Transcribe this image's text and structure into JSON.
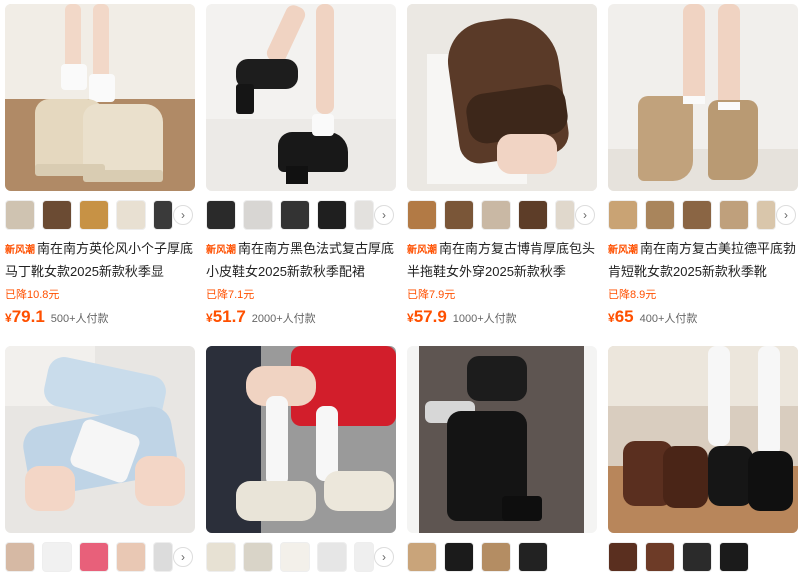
{
  "products": [
    {
      "badge": "新风潮",
      "title": "南在南方英伦风小个子厚底马丁靴女款2025新款秋季显",
      "dropped": "已降10.8元",
      "currency": "¥",
      "price": "79.1",
      "sold": "500+人付款"
    },
    {
      "badge": "新风潮",
      "title": "南在南方黑色法式复古厚底小皮鞋女2025新款秋季配裙",
      "dropped": "已降7.1元",
      "currency": "¥",
      "price": "51.7",
      "sold": "2000+人付款"
    },
    {
      "badge": "新风潮",
      "title": "南在南方复古博肯厚底包头半拖鞋女外穿2025新款秋季",
      "dropped": "已降7.9元",
      "currency": "¥",
      "price": "57.9",
      "sold": "1000+人付款"
    },
    {
      "badge": "新风潮",
      "title": "南在南方复古美拉德平底勃肯短靴女款2025新款秋季靴",
      "dropped": "已降8.9元",
      "currency": "¥",
      "price": "65",
      "sold": "400+人付款"
    }
  ],
  "thumb_next_label": "›",
  "colors": {
    "accent": "#ff5000"
  }
}
